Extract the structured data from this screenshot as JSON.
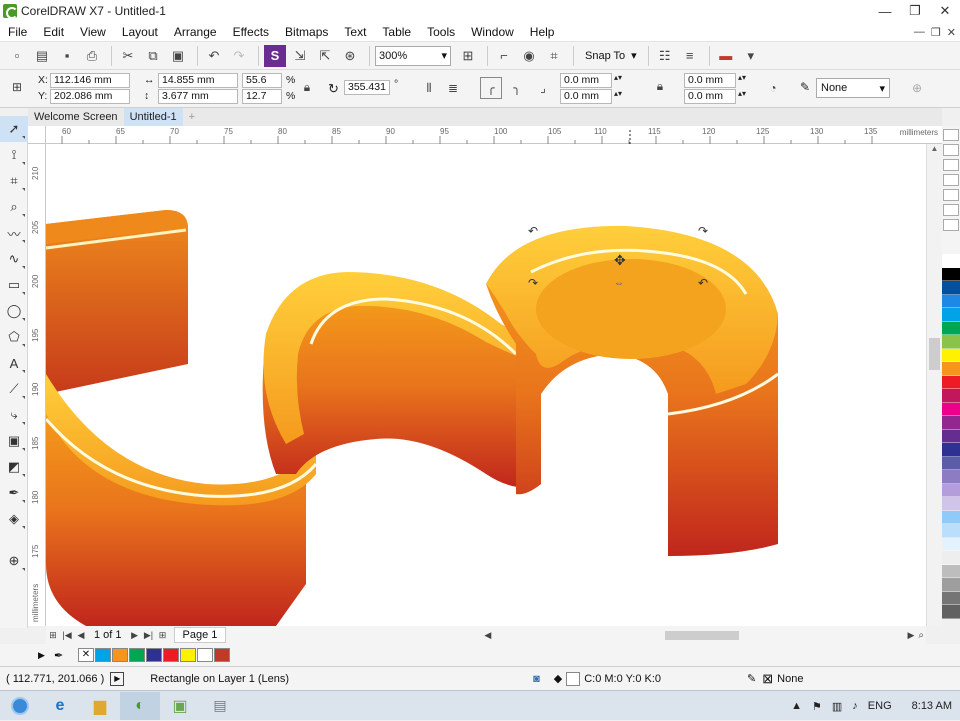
{
  "window": {
    "title": "CorelDRAW X7 - Untitled-1",
    "minimize": "—",
    "restore": "❐",
    "close": "✕"
  },
  "menu": [
    "File",
    "Edit",
    "View",
    "Layout",
    "Arrange",
    "Effects",
    "Bitmaps",
    "Text",
    "Table",
    "Tools",
    "Window",
    "Help"
  ],
  "toolbar": {
    "zoom": "300%",
    "snap_label": "Snap To"
  },
  "properties": {
    "x_label": "X:",
    "y_label": "Y:",
    "x_value": "112.146 mm",
    "y_value": "202.086 mm",
    "width_value": "14.855 mm",
    "height_value": "3.677 mm",
    "scale_x": "55.6",
    "scale_y": "12.7",
    "percent": "%",
    "rotation": "355.431",
    "degree": "°",
    "corner_1": "0.0 mm",
    "corner_2": "0.0 mm",
    "corner_3": "0.0 mm",
    "corner_4": "0.0 mm",
    "outline": "None"
  },
  "tabs": {
    "welcome": "Welcome Screen",
    "document": "Untitled-1",
    "add": "+"
  },
  "ruler": {
    "h_labels": [
      "60",
      "65",
      "70",
      "75",
      "80",
      "85",
      "90",
      "95",
      "100",
      "105",
      "110",
      "115",
      "120",
      "125",
      "130",
      "135"
    ],
    "v_labels": [
      "210",
      "205",
      "200",
      "195",
      "190",
      "185",
      "180",
      "175"
    ],
    "unit": "millimeters"
  },
  "navigation": {
    "page_count": "1 of 1",
    "page_tab": "Page 1"
  },
  "palette_colors": [
    "#ffffff",
    "#000000",
    "#0050a0",
    "#1e88e5",
    "#00a2e8",
    "#00a651",
    "#8bc34a",
    "#fff200",
    "#f7941d",
    "#ed1c24",
    "#c2185b",
    "#ec008c",
    "#92278f",
    "#662d91",
    "#2e3192",
    "#5b5ea6",
    "#8e7cc3",
    "#b39ddb",
    "#d1c4e9",
    "#90caf9",
    "#bbdefb",
    "#e3f2fd",
    "#eeeeee",
    "#bdbdbd",
    "#9e9e9e",
    "#757575",
    "#616161"
  ],
  "doc_palette_colors": [
    "#ffffff",
    "#00a2e8",
    "#f7941d",
    "#00a651",
    "#2e3192",
    "#ed1c24",
    "#fff200",
    "#ffffff",
    "#c0392b"
  ],
  "status": {
    "cursor_pos": "( 112.771, 201.066 )",
    "object_info": "Rectangle on Layer 1  (Lens)",
    "fill_info": "C:0 M:0 Y:0 K:0",
    "outline_info": "None"
  },
  "taskbar": {
    "language": "ENG",
    "time": "8:13 AM"
  }
}
